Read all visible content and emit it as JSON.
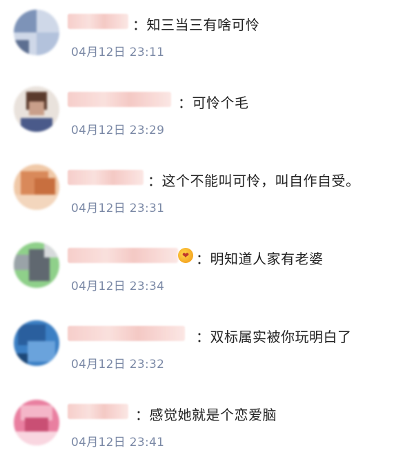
{
  "comments": [
    {
      "text": "：知三当三有啥可怜",
      "time": "04月12日 23:11",
      "avatar_colors": [
        "#cfd8e8",
        "#7d93b8",
        "#b3c2dc",
        "#5d6f91"
      ]
    },
    {
      "text": "：可怜个毛",
      "time": "04月12日 23:29",
      "avatar_colors": [
        "#e9e2dc",
        "#5a3a2c",
        "#c99f8a",
        "#4a5a8a"
      ]
    },
    {
      "text": "：这个不能叫可怜，叫自作自受。",
      "time": "04月12日 23:31",
      "avatar_colors": [
        "#f0c9a8",
        "#d9895a",
        "#c86f3f",
        "#f3d6bd"
      ]
    },
    {
      "text": "：明知道人家有老婆",
      "time": "04月12日 23:34",
      "avatar_colors": [
        "#8fd08a",
        "#9aa3a8",
        "#606870",
        "#d7dadc"
      ]
    },
    {
      "text": "：双标属实被你玩明白了",
      "time": "04月12日 23:32",
      "avatar_colors": [
        "#3b7fc4",
        "#2a5f9e",
        "#6aa3dc",
        "#1d4878"
      ]
    },
    {
      "text": "：感觉她就是个恋爱脑",
      "time": "04月12日 23:41",
      "avatar_colors": [
        "#e97fa0",
        "#f4b6c8",
        "#c94f74",
        "#f9d6e0"
      ]
    }
  ],
  "vip_badge_glyph": "❤"
}
